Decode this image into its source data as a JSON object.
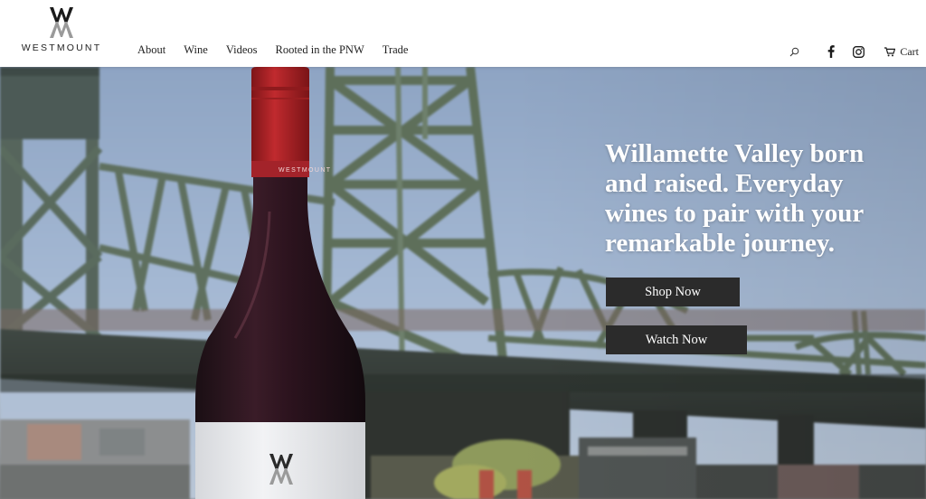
{
  "brand": {
    "name": "WESTMOUNT"
  },
  "nav": {
    "items": [
      {
        "label": "About"
      },
      {
        "label": "Wine"
      },
      {
        "label": "Videos"
      },
      {
        "label": "Rooted in the PNW"
      },
      {
        "label": "Trade"
      }
    ]
  },
  "header_actions": {
    "search_icon": "search-icon",
    "facebook_icon": "facebook-icon",
    "instagram_icon": "instagram-icon",
    "cart_icon": "cart-icon",
    "cart_label": "Cart"
  },
  "hero": {
    "headline": "Willamette Valley born and raised. Everyday wines to pair with your remarkable journey.",
    "buttons": [
      {
        "label": "Shop Now"
      },
      {
        "label": "Watch Now"
      }
    ],
    "bottle_capsule_text": "WESTMOUNT"
  },
  "colors": {
    "button_bg": "#2b2b2b",
    "capsule_red": "#b3262a",
    "bridge_green": "#5e6f5a"
  }
}
